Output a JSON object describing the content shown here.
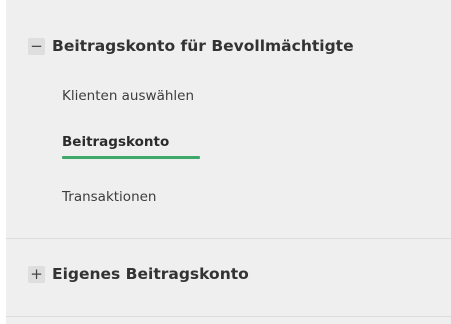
{
  "sections": [
    {
      "toggle_symbol": "−",
      "title": "Beitragskonto für Bevollmächtigte",
      "expanded": true,
      "items": [
        {
          "label": "Klienten auswählen",
          "active": false
        },
        {
          "label": "Beitragskonto",
          "active": true
        },
        {
          "label": "Transaktionen",
          "active": false
        }
      ]
    },
    {
      "toggle_symbol": "+",
      "title": "Eigenes Beitragskonto",
      "expanded": false,
      "items": []
    }
  ],
  "colors": {
    "panel_background": "#efefef",
    "active_underline": "#3fa86b",
    "toggle_background": "#dedede"
  }
}
